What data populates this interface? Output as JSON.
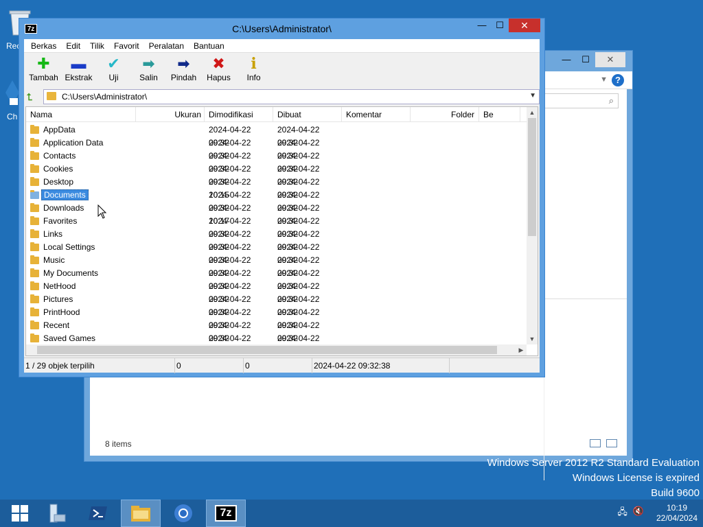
{
  "desktop": {
    "recycle_label": "Rec",
    "chrome_label": "Ch",
    "watermark": [
      "Windows Server 2012 R2 Standard Evaluation",
      "Windows License is expired",
      "Build 9600"
    ]
  },
  "explorer_bg": {
    "items_count": "8 items",
    "help": "?"
  },
  "sevenzip": {
    "title": "C:\\Users\\Administrator\\",
    "logo": "7z",
    "menu": [
      "Berkas",
      "Edit",
      "Tilik",
      "Favorit",
      "Peralatan",
      "Bantuan"
    ],
    "toolbar": [
      {
        "label": "Tambah",
        "icon": "plus-icon",
        "glyph": "✚",
        "color": "#16b816"
      },
      {
        "label": "Ekstrak",
        "icon": "minus-icon",
        "glyph": "▬",
        "color": "#1a3cc8"
      },
      {
        "label": "Uji",
        "icon": "check-icon",
        "glyph": "✔",
        "color": "#27b8c8"
      },
      {
        "label": "Salin",
        "icon": "copy-arrow-icon",
        "glyph": "➡",
        "color": "#2a9a9a"
      },
      {
        "label": "Pindah",
        "icon": "move-arrow-icon",
        "glyph": "➡",
        "color": "#102a8a"
      },
      {
        "label": "Hapus",
        "icon": "delete-x-icon",
        "glyph": "✖",
        "color": "#d01818"
      },
      {
        "label": "Info",
        "icon": "info-icon",
        "glyph": "i",
        "color": "#c8a000"
      }
    ],
    "address": "C:\\Users\\Administrator\\",
    "columns": {
      "name": "Nama",
      "size": "Ukuran",
      "modified": "Dimodifikasi",
      "created": "Dibuat",
      "comment": "Komentar",
      "folder": "Folder",
      "be": "Be"
    },
    "rows": [
      {
        "name": "AppData",
        "modified": "2024-04-22 09:32",
        "created": "2024-04-22 09:32"
      },
      {
        "name": "Application Data",
        "modified": "2024-04-22 09:32",
        "created": "2024-04-22 09:32"
      },
      {
        "name": "Contacts",
        "modified": "2024-04-22 09:32",
        "created": "2024-04-22 09:32"
      },
      {
        "name": "Cookies",
        "modified": "2024-04-22 09:32",
        "created": "2024-04-22 09:32"
      },
      {
        "name": "Desktop",
        "modified": "2024-04-22 10:15",
        "created": "2024-04-22 09:32"
      },
      {
        "name": "Documents",
        "modified": "2024-04-22 09:32",
        "created": "2024-04-22 09:32",
        "selected": true
      },
      {
        "name": "Downloads",
        "modified": "2024-04-22 10:17",
        "created": "2024-04-22 09:32"
      },
      {
        "name": "Favorites",
        "modified": "2024-04-22 09:32",
        "created": "2024-04-22 09:32"
      },
      {
        "name": "Links",
        "modified": "2024-04-22 09:32",
        "created": "2024-04-22 09:32"
      },
      {
        "name": "Local Settings",
        "modified": "2024-04-22 09:32",
        "created": "2024-04-22 09:32"
      },
      {
        "name": "Music",
        "modified": "2024-04-22 09:32",
        "created": "2024-04-22 09:32"
      },
      {
        "name": "My Documents",
        "modified": "2024-04-22 09:32",
        "created": "2024-04-22 09:32"
      },
      {
        "name": "NetHood",
        "modified": "2024-04-22 09:32",
        "created": "2024-04-22 09:32"
      },
      {
        "name": "Pictures",
        "modified": "2024-04-22 09:32",
        "created": "2024-04-22 09:32"
      },
      {
        "name": "PrintHood",
        "modified": "2024-04-22 09:32",
        "created": "2024-04-22 09:32"
      },
      {
        "name": "Recent",
        "modified": "2024-04-22 09:32",
        "created": "2024-04-22 09:32"
      },
      {
        "name": "Saved Games",
        "modified": "2024-04-22 09:32",
        "created": "2024-04-22 09:32"
      }
    ],
    "status": {
      "selection": "1 / 29 objek terpilih",
      "size": "0",
      "packed": "0",
      "datetime": "2024-04-22 09:32:38"
    }
  },
  "taskbar": {
    "time": "10:19",
    "date": "22/04/2024",
    "seven_zip_label": "7z"
  }
}
